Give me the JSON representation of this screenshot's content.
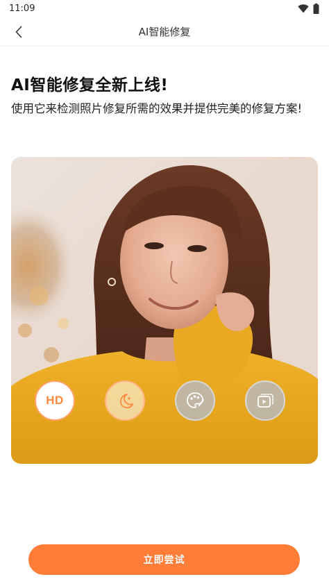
{
  "status_bar": {
    "time": "11:09"
  },
  "nav": {
    "title": "AI智能修复"
  },
  "main": {
    "headline": "AI智能修复全新上线!",
    "description": "使用它来检测照片修复所需的效果并提供完美的修复方案!"
  },
  "features": [
    {
      "label": "HD",
      "icon": "hd-icon"
    },
    {
      "icon": "moon-icon"
    },
    {
      "icon": "palette-icon"
    },
    {
      "icon": "video-icon"
    }
  ],
  "cta": {
    "label": "立即尝试"
  },
  "colors": {
    "accent": "#ff7d36",
    "hd_text": "#ff8a3d"
  }
}
